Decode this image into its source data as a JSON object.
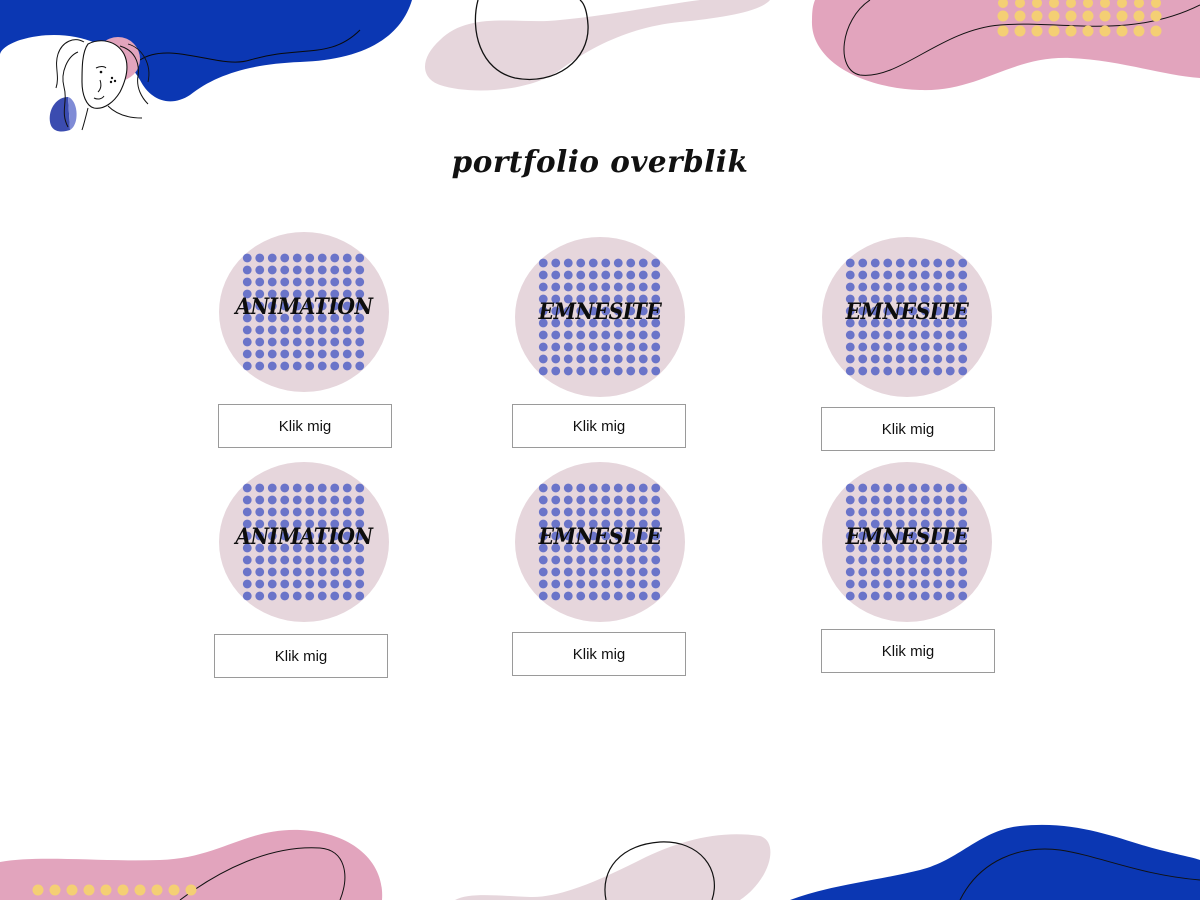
{
  "page": {
    "title": "portfolio overblik"
  },
  "colors": {
    "blue": "#0b37b3",
    "pink": "#e2a4bd",
    "blush": "#e6d6dc",
    "dot_purple": "#6a74c9",
    "dot_yellow": "#f4cf74"
  },
  "logo": {
    "icon": "woman-line-portrait-icon"
  },
  "portfolio": {
    "items": [
      {
        "label": "ANIMATION",
        "button_label": "Klik mig"
      },
      {
        "label": "EMNESITE",
        "button_label": "Klik mig"
      },
      {
        "label": "EMNESITE",
        "button_label": "Klik mig"
      },
      {
        "label": "ANIMATION",
        "button_label": "Klik mig"
      },
      {
        "label": "EMNESITE",
        "button_label": "Klik mig"
      },
      {
        "label": "EMNESITE",
        "button_label": "Klik mig"
      }
    ]
  }
}
